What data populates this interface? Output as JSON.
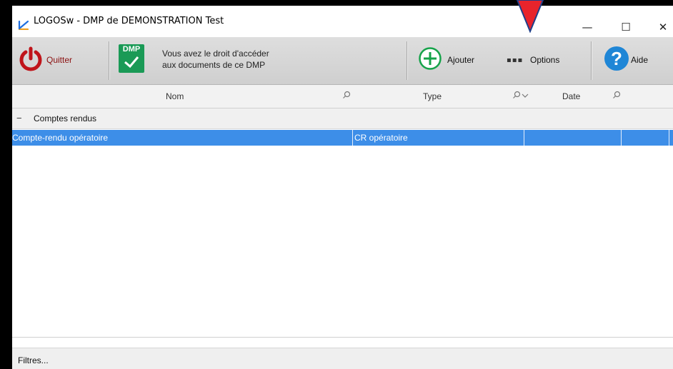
{
  "window": {
    "title": "LOGOSw - DMP de DEMONSTRATION Test",
    "min_glyph": "—",
    "max_glyph": "☐",
    "close_glyph": "✕"
  },
  "toolbar": {
    "quit_label": "Quitter",
    "dmp_badge": "DMP",
    "dmp_message_line1": "Vous avez le droit d'accéder",
    "dmp_message_line2": "aux documents de ce DMP",
    "add_label": "Ajouter",
    "options_dots": "▪▪▪",
    "options_label": "Options",
    "help_glyph": "?",
    "help_label": "Aide"
  },
  "grid": {
    "columns": [
      {
        "label": "Nom"
      },
      {
        "label": "Type"
      },
      {
        "label": "Date"
      }
    ],
    "group": {
      "toggle": "−",
      "label": "Comptes rendus"
    },
    "rows": [
      {
        "nom": "Compte-rendu opératoire",
        "type": "CR opératoire",
        "date": "",
        "extra": ""
      }
    ]
  },
  "status": {
    "filters_label": "Filtres..."
  },
  "colors": {
    "selection": "#3d8ee8",
    "quit": "#c0141a",
    "add": "#16a34a",
    "help": "#1f86d6",
    "dmp": "#1a9a56",
    "arrow": "#e8242c"
  },
  "icons": {
    "quit": "power-icon",
    "dmp": "dmp-check-icon",
    "add": "plus-circle-icon",
    "options": "more-dots-icon",
    "help": "question-icon",
    "search": "search-icon"
  }
}
